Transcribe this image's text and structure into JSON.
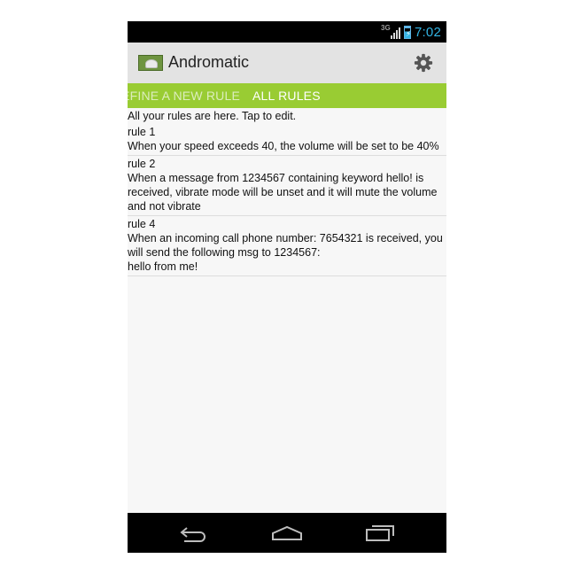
{
  "status_bar": {
    "network_label": "3G",
    "time": "7:02",
    "icons": [
      "signal-icon",
      "battery-charging-icon"
    ]
  },
  "action_bar": {
    "title": "Andromatic",
    "icons": [
      "app-icon",
      "gear-icon"
    ]
  },
  "tabs": [
    {
      "label": "EFINE A NEW RULE",
      "active": false
    },
    {
      "label": "ALL RULES",
      "active": true
    }
  ],
  "colors": {
    "tab_strip": "#99cc33",
    "clock": "#33b5e5"
  },
  "content": {
    "intro": "All your rules are here. Tap to edit.",
    "rules": [
      {
        "name": "rule 1",
        "description": "When your speed exceeds 40, the volume will be set to be 40%"
      },
      {
        "name": "rule 2",
        "description": "When a message from 1234567 containing keyword hello! is received, vibrate mode will be unset and it will mute the volume and not vibrate"
      },
      {
        "name": "rule 4",
        "description": "When an incoming call phone number: 7654321 is received, you will send the following msg to 1234567:\nhello from me!"
      }
    ]
  },
  "nav_bar": {
    "icons": [
      "back-icon",
      "home-icon",
      "recents-icon"
    ]
  }
}
